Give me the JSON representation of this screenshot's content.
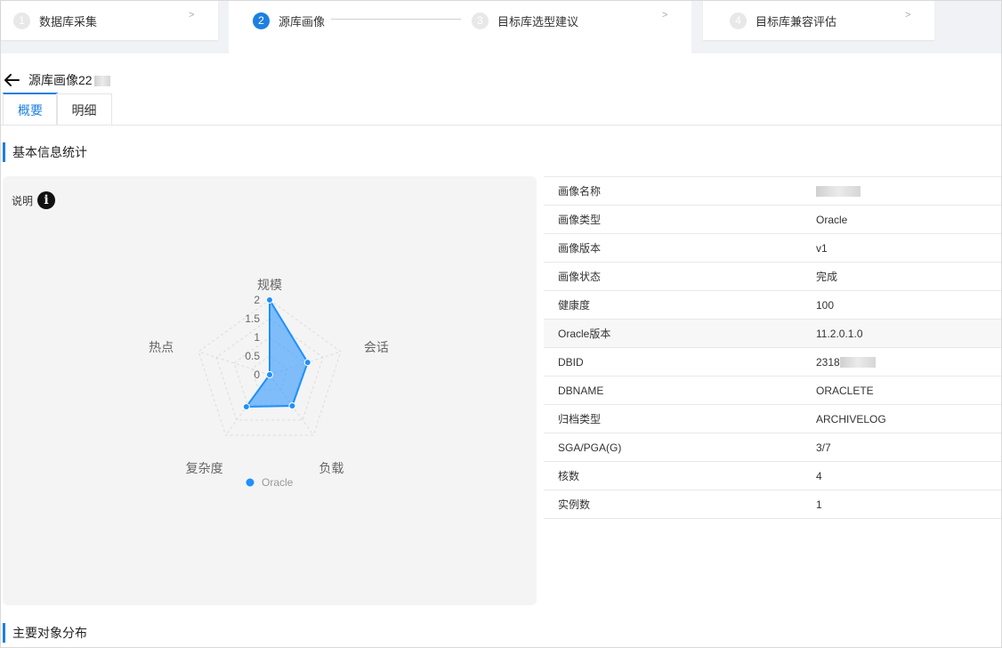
{
  "steps": [
    {
      "num": "1",
      "label": "数据库采集",
      "chev": ">"
    },
    {
      "num": "2",
      "label": "源库画像"
    },
    {
      "num": "3",
      "label": "目标库选型建议",
      "chev": ">"
    },
    {
      "num": "4",
      "label": "目标库兼容评估",
      "chev": ">"
    }
  ],
  "title": "源库画像22",
  "tabs": [
    "概要",
    "明细"
  ],
  "sections": {
    "basic": "基本信息统计",
    "objects": "主要对象分布"
  },
  "panel": {
    "desc_label": "说明",
    "info_glyph": "i"
  },
  "chart_data": {
    "type": "radar",
    "axes": [
      "规模",
      "会话",
      "负载",
      "复杂度",
      "热点"
    ],
    "ticks": [
      "2",
      "1.5",
      "1",
      "0.5",
      "0"
    ],
    "max": 2,
    "series": [
      {
        "name": "Oracle",
        "values": [
          2,
          1.07,
          1.03,
          1.06,
          0
        ]
      }
    ],
    "color": "#1e90ff",
    "legend_position": "bottom"
  },
  "info": [
    {
      "k": "画像名称",
      "v": ""
    },
    {
      "k": "画像类型",
      "v": "Oracle"
    },
    {
      "k": "画像版本",
      "v": "v1"
    },
    {
      "k": "画像状态",
      "v": "完成"
    },
    {
      "k": "健康度",
      "v": "100"
    },
    {
      "k": "Oracle版本",
      "v": "11.2.0.1.0"
    },
    {
      "k": "DBID",
      "v": "2318"
    },
    {
      "k": "DBNAME",
      "v": "ORACLETE"
    },
    {
      "k": "归档类型",
      "v": "ARCHIVELOG"
    },
    {
      "k": "SGA/PGA(G)",
      "v": "3/7"
    },
    {
      "k": "核数",
      "v": "4"
    },
    {
      "k": "实例数",
      "v": "1"
    }
  ],
  "colors": {
    "accent": "#1e7fe0"
  }
}
